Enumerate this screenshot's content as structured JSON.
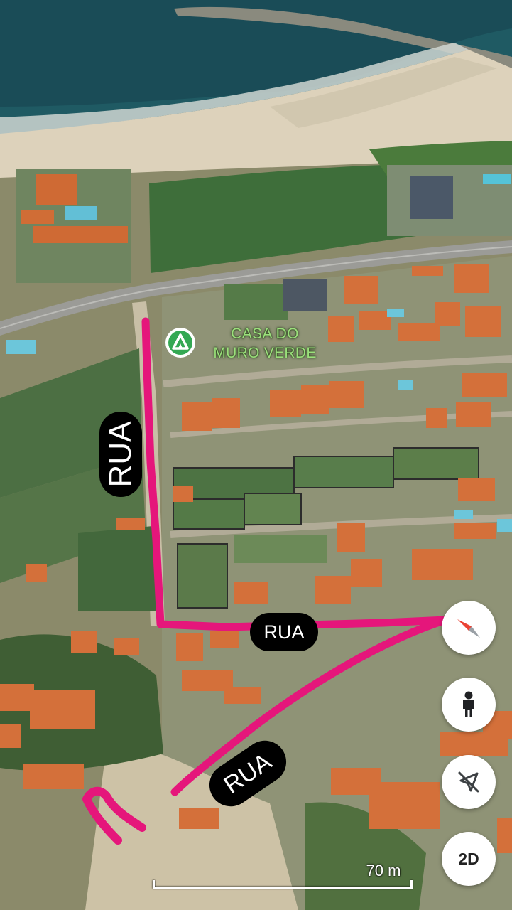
{
  "place": {
    "name": "CASA DO\nMURO VERDE",
    "icon": "campground-icon",
    "pin_color": "#34a853"
  },
  "annotations": {
    "route_color": "#e5167b",
    "road_labels": [
      "RUA",
      "RUA",
      "RUA"
    ]
  },
  "controls": {
    "compass_icon": "compass-icon",
    "street_view_icon": "pegman-icon",
    "location_icon": "location-off-icon",
    "view_toggle_label": "2D"
  },
  "scale": {
    "label": "70 m"
  }
}
